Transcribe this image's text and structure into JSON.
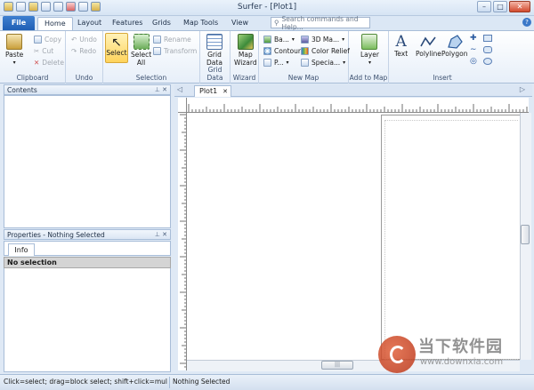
{
  "window": {
    "title": "Surfer - [Plot1]"
  },
  "colors": {
    "accent": "#1f5fb5",
    "ribbon_bg": "#e7eff9",
    "selected": "#ffd45c",
    "status_bg": "#d3e0ef"
  },
  "tabs": {
    "file": "File",
    "home": "Home",
    "layout": "Layout",
    "features": "Features",
    "grids": "Grids",
    "map_tools": "Map Tools",
    "view": "View"
  },
  "search": {
    "placeholder": "Search commands and Help..."
  },
  "ribbon": {
    "clipboard": {
      "paste": "Paste",
      "copy": "Copy",
      "cut": "Cut",
      "delete": "Delete",
      "label": "Clipboard"
    },
    "undo": {
      "undo": "Undo",
      "redo": "Redo",
      "label": "Undo"
    },
    "selection": {
      "select": "Select",
      "select_all_1": "Select",
      "select_all_2": "All",
      "rename": "Rename",
      "transform": "Transform",
      "label": "Selection"
    },
    "grid_data": {
      "btn_1": "Grid",
      "btn_2": "Data",
      "label": "Grid Data"
    },
    "wizard": {
      "btn_1": "Map",
      "btn_2": "Wizard",
      "label": "Wizard"
    },
    "new_map": {
      "base": "Ba...",
      "contour": "Contour",
      "post": "P...",
      "map3d": "3D Ma...",
      "color_relief": "Color Relief",
      "special": "Specia...",
      "label": "New Map"
    },
    "add_to_map": {
      "layer": "Layer",
      "label": "Add to Map"
    },
    "insert": {
      "text": "Text",
      "polyline": "Polyline",
      "polygon": "Polygon",
      "label": "Insert"
    }
  },
  "contents_panel": {
    "title": "Contents"
  },
  "properties_panel": {
    "title": "Properties - Nothing Selected",
    "tab": "Info",
    "selection": "No selection"
  },
  "document": {
    "tab": "Plot1"
  },
  "statusbar": {
    "hint": "Click=select; drag=block select; shift+click=multi-sele...",
    "state": "Nothing Selected"
  },
  "watermark": {
    "brand": "当下软件园",
    "url": "www.downxia.com"
  }
}
